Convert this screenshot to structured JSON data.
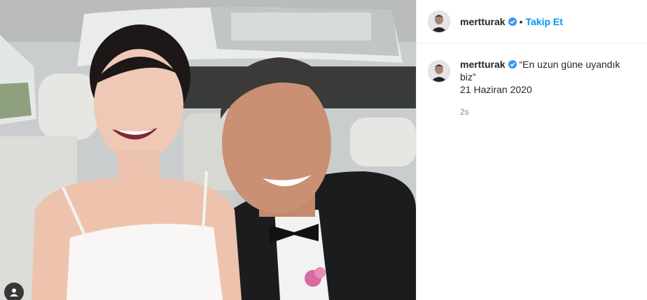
{
  "post": {
    "username": "mertturak",
    "follow_label": "Takip Et",
    "separator": "•",
    "caption_line1": "“En uzun güne uyandık biz”",
    "caption_line2": "21 Haziran 2020",
    "time_ago": "2s"
  },
  "colors": {
    "link_blue": "#0095f6",
    "verified_blue": "#3897f0",
    "text": "#262626",
    "muted": "#8e8e8e"
  },
  "icons": {
    "verified": "verified-badge-icon",
    "tag": "user-tag-icon"
  }
}
